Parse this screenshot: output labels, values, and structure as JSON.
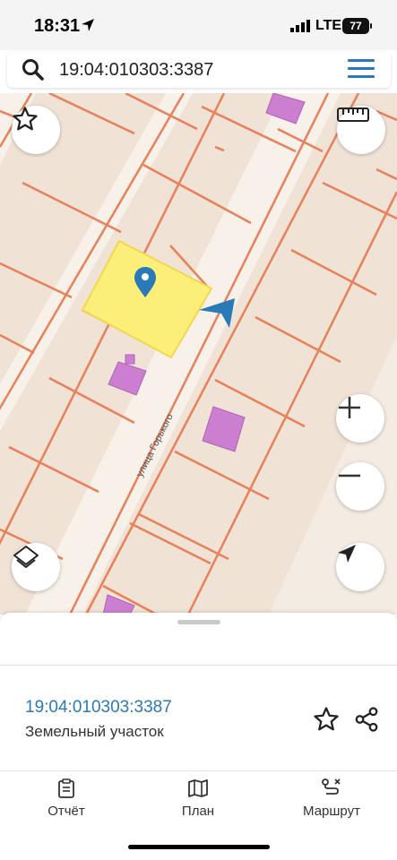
{
  "status_bar": {
    "time": "18:31",
    "network": "LTE",
    "battery": "77",
    "icons": [
      "location-arrow-icon",
      "signal-bars-icon",
      "battery-icon"
    ]
  },
  "search": {
    "query": "19:04:010303:3387",
    "icons": [
      "search-icon",
      "hamburger-menu-icon"
    ]
  },
  "map": {
    "street_label": "улица Горького",
    "controls": [
      "favorite-star-icon",
      "ruler-icon",
      "zoom-in-icon",
      "zoom-out-icon",
      "layers-icon",
      "my-location-icon"
    ],
    "colors": {
      "background": "#f1e2d6",
      "parcel_border": "#e8805a",
      "road": "#f7f1ea",
      "building": "#cc7fd0",
      "selected_parcel": "#fbef7a",
      "marker": "#2a79b8"
    }
  },
  "sheet": {
    "parcel_id": "19:04:010303:3387",
    "parcel_type": "Земельный участок",
    "actions": [
      "favorite-star-icon",
      "share-icon"
    ]
  },
  "tabs": [
    {
      "label": "Отчёт",
      "icon": "report-icon"
    },
    {
      "label": "План",
      "icon": "map-plan-icon"
    },
    {
      "label": "Маршрут",
      "icon": "route-icon"
    }
  ]
}
